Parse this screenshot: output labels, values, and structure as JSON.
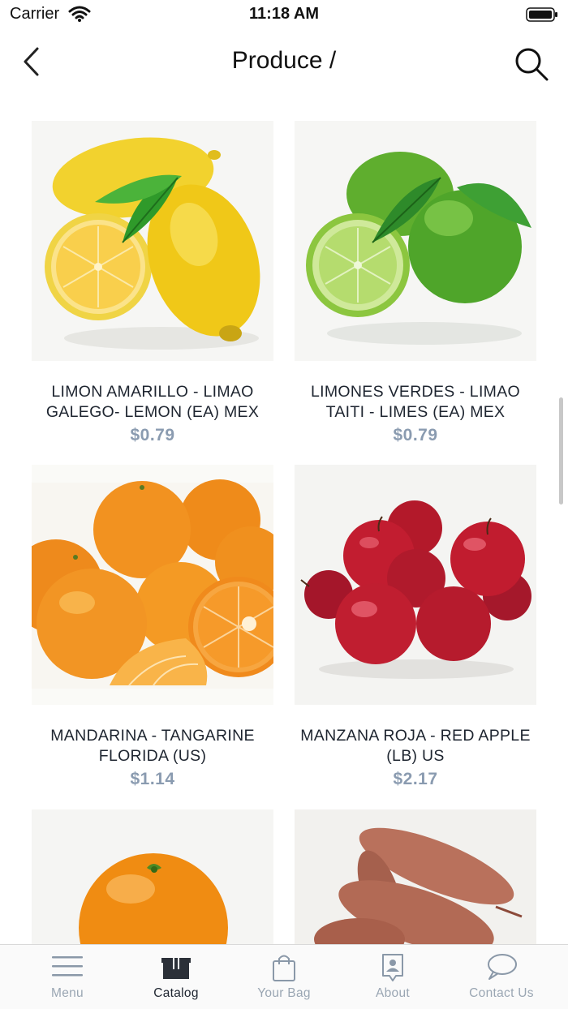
{
  "status_bar": {
    "carrier": "Carrier",
    "time": "11:18 AM"
  },
  "nav": {
    "title": "Produce /"
  },
  "products": [
    {
      "name": "LIMON AMARILLO - LIMAO GALEGO- LEMON (EA) MEX",
      "price": "$0.79",
      "image": "lemons"
    },
    {
      "name": "LIMONES VERDES - LIMAO TAITI - LIMES (EA) MEX",
      "price": "$0.79",
      "image": "limes"
    },
    {
      "name": "MANDARINA - TANGARINE FLORIDA (US)",
      "price": "$1.14",
      "image": "tangerines"
    },
    {
      "name": "MANZANA ROJA - RED APPLE (LB) US",
      "price": "$2.17",
      "image": "red-apples"
    },
    {
      "name": "",
      "price": "",
      "image": "orange"
    },
    {
      "name": "",
      "price": "",
      "image": "sweet-potatoes"
    }
  ],
  "tabs": [
    {
      "label": "Menu",
      "icon": "menu-icon",
      "active": false
    },
    {
      "label": "Catalog",
      "icon": "catalog-box-icon",
      "active": true
    },
    {
      "label": "Your Bag",
      "icon": "shopping-bag-icon",
      "active": false
    },
    {
      "label": "About",
      "icon": "about-badge-icon",
      "active": false
    },
    {
      "label": "Contact Us",
      "icon": "chat-bubble-icon",
      "active": false
    }
  ],
  "colors": {
    "price": "#8a9bb0",
    "tab_inactive": "#9aa6b3",
    "tab_active": "#1e2530"
  }
}
